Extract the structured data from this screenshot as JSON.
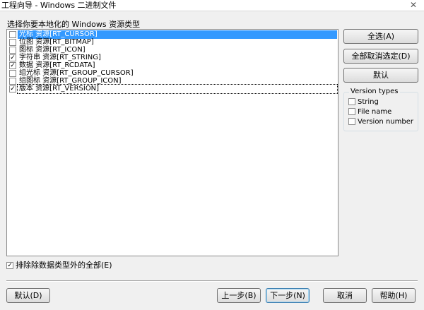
{
  "window": {
    "title": "工程向导 - Windows 二进制文件",
    "close_glyph": "✕"
  },
  "instruction": "选择你要本地化的 Windows 资源类型",
  "resources": [
    {
      "label": "光标 资源[RT_CURSOR]",
      "checked": false,
      "selected": true
    },
    {
      "label": "位图 资源[RT_BITMAP]",
      "checked": false
    },
    {
      "label": "图标 资源[RT_ICON]",
      "checked": false
    },
    {
      "label": "字符串 资源[RT_STRING]",
      "checked": true
    },
    {
      "label": "数据 资源[RT_RCDATA]",
      "checked": true
    },
    {
      "label": "组光标 资源[RT_GROUP_CURSOR]",
      "checked": false
    },
    {
      "label": "组图标 资源[RT_GROUP_ICON]",
      "checked": false
    },
    {
      "label": "版本 资源[RT_VERSION]",
      "checked": true,
      "focused": true
    }
  ],
  "side_buttons": {
    "select_all": "全选(A)",
    "deselect_all": "全部取消选定(D)",
    "default": "默认"
  },
  "version_types": {
    "legend": "Version types",
    "options": [
      {
        "label": "String",
        "checked": false
      },
      {
        "label": "File name",
        "checked": false
      },
      {
        "label": "Version number",
        "checked": false
      }
    ]
  },
  "exclude_option": {
    "label": "排除除数据类型外的全部(E)",
    "checked": true
  },
  "bottom_buttons": {
    "default": "默认(D)",
    "back": "上一步(B)",
    "next": "下一步(N)",
    "cancel": "取消",
    "help": "帮助(H)"
  },
  "check_glyph": "✓"
}
